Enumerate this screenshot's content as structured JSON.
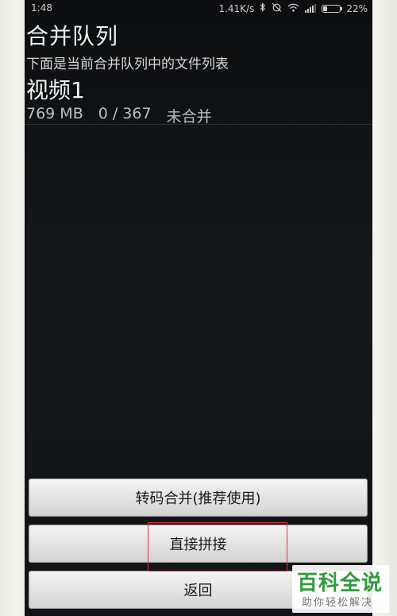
{
  "status_bar": {
    "time": "1:48",
    "net_speed": "1.41K/s",
    "battery": "22%",
    "icons": [
      "bluetooth-icon",
      "alarm-off-icon",
      "wifi-icon",
      "signal-icon",
      "battery-icon"
    ]
  },
  "header": {
    "title": "合并队列",
    "subtitle": "下面是当前合并队列中的文件列表"
  },
  "queue": {
    "items": [
      {
        "name": "视频1",
        "size": "769 MB",
        "progress": "0 / 367",
        "status": "未合并"
      }
    ]
  },
  "buttons": {
    "transcode_merge": "转码合并(推荐使用)",
    "direct_concat": "直接拼接",
    "back": "返回"
  },
  "watermark": {
    "title": "百科全说",
    "slogan": "助你轻松解决"
  },
  "colors": {
    "screen_bg": "#111316",
    "highlight": "#d8353a",
    "watermark_green": "#2f9b3a"
  }
}
